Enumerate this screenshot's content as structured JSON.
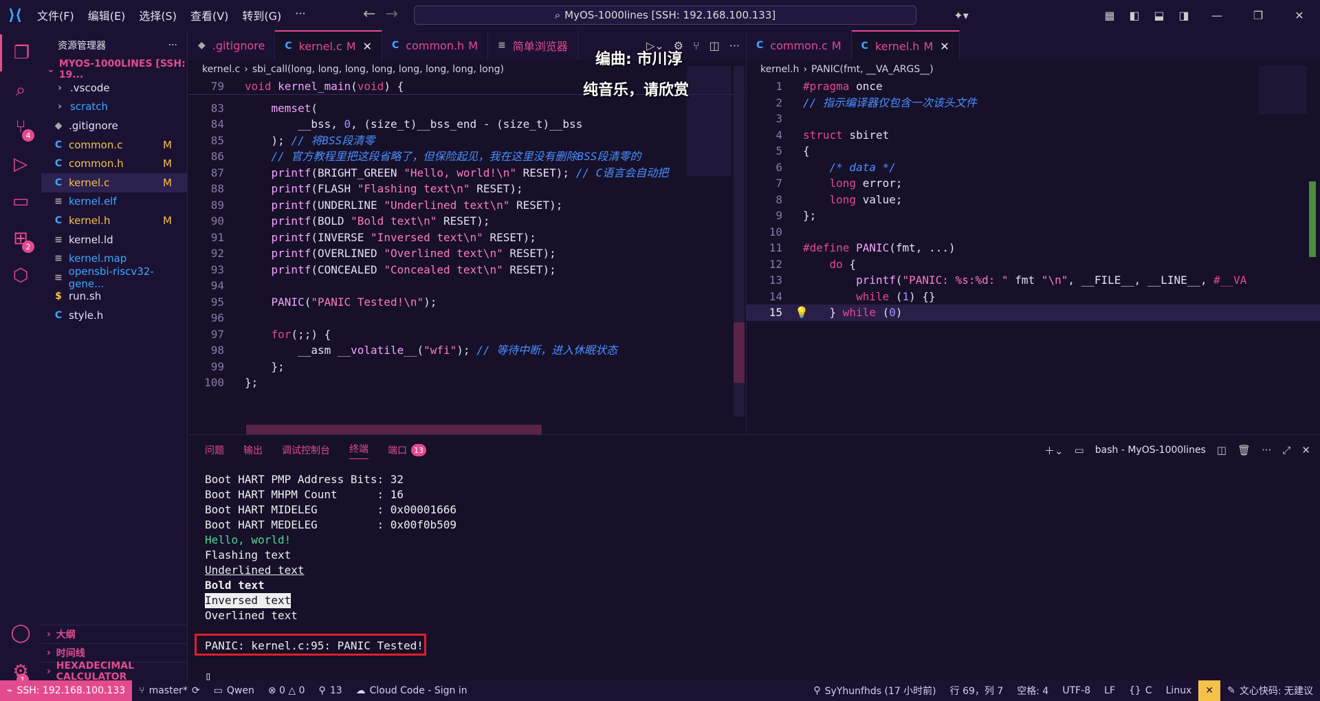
{
  "titlebar": {
    "menus": [
      "文件(F)",
      "编辑(E)",
      "选择(S)",
      "查看(V)",
      "转到(G)",
      "···"
    ],
    "command_center": "MyOS-1000lines [SSH: 192.168.100.133]"
  },
  "activity": {
    "scm_badge": "4",
    "ext_badge": "2",
    "settings_badge": "1"
  },
  "sidebar": {
    "title": "资源管理器",
    "project": "MYOS-1000LINES [SSH: 19...",
    "items": [
      {
        "icon": "›",
        "label": ".vscode",
        "color": "#e6e0f2",
        "mod": ""
      },
      {
        "icon": "›",
        "label": "scratch",
        "color": "#3fa7ff",
        "mod": ""
      },
      {
        "icon": "◆",
        "label": ".gitignore",
        "color": "#e6e0f2",
        "mod": ""
      },
      {
        "icon": "C",
        "label": "common.c",
        "color": "#f5c249",
        "mod": "M"
      },
      {
        "icon": "C",
        "label": "common.h",
        "color": "#f5c249",
        "mod": "M"
      },
      {
        "icon": "C",
        "label": "kernel.c",
        "color": "#f5c249",
        "mod": "M"
      },
      {
        "icon": "≡",
        "label": "kernel.elf",
        "color": "#3fa7ff",
        "mod": ""
      },
      {
        "icon": "C",
        "label": "kernel.h",
        "color": "#f5c249",
        "mod": "M"
      },
      {
        "icon": "≡",
        "label": "kernel.ld",
        "color": "#e6e0f2",
        "mod": ""
      },
      {
        "icon": "≡",
        "label": "kernel.map",
        "color": "#3fa7ff",
        "mod": ""
      },
      {
        "icon": "≡",
        "label": "opensbi-riscv32-gene...",
        "color": "#3fa7ff",
        "mod": ""
      },
      {
        "icon": "$",
        "label": "run.sh",
        "color": "#e6e0f2",
        "mod": ""
      },
      {
        "icon": "C",
        "label": "style.h",
        "color": "#e6e0f2",
        "mod": ""
      }
    ],
    "sections": [
      "大纲",
      "时间线",
      "HEXADECIMAL CALCULATOR"
    ]
  },
  "left_editor": {
    "tabs": [
      {
        "icon": "◆",
        "label": ".gitignore",
        "mod": ""
      },
      {
        "icon": "C",
        "label": "kernel.c",
        "mod": "M",
        "close": "✕"
      },
      {
        "icon": "C",
        "label": "common.h",
        "mod": "M"
      },
      {
        "icon": "≡",
        "label": "简单浏览器",
        "mod": ""
      }
    ],
    "breadcrumb": [
      "kernel.c",
      "sbi_call(long, long, long, long, long, long, long, long)"
    ],
    "sticky": {
      "n": "79",
      "text": "void kernel_main(void) {"
    },
    "lines": [
      {
        "n": "83",
        "text": "    memset("
      },
      {
        "n": "84",
        "text": "        __bss, 0, (size_t)__bss_end - (size_t)__bss"
      },
      {
        "n": "85",
        "text": "    ); // 将BSS段清零"
      },
      {
        "n": "86",
        "text": "    // 官方教程里把这段省略了，但保险起见，我在这里没有删除BSS段清零的"
      },
      {
        "n": "87",
        "text": "    printf(BRIGHT_GREEN \"Hello, world!\\n\" RESET); // C语言会自动把"
      },
      {
        "n": "88",
        "text": "    printf(FLASH \"Flashing text\\n\" RESET);"
      },
      {
        "n": "89",
        "text": "    printf(UNDERLINE \"Underlined text\\n\" RESET);"
      },
      {
        "n": "90",
        "text": "    printf(BOLD \"Bold text\\n\" RESET);"
      },
      {
        "n": "91",
        "text": "    printf(INVERSE \"Inversed text\\n\" RESET);"
      },
      {
        "n": "92",
        "text": "    printf(OVERLINED \"Overlined text\\n\" RESET);"
      },
      {
        "n": "93",
        "text": "    printf(CONCEALED \"Concealed text\\n\" RESET);"
      },
      {
        "n": "94",
        "text": ""
      },
      {
        "n": "95",
        "text": "    PANIC(\"PANIC Tested!\\n\");"
      },
      {
        "n": "96",
        "text": ""
      },
      {
        "n": "97",
        "text": "    for(;;) {"
      },
      {
        "n": "98",
        "text": "        __asm __volatile__(\"wfi\"); // 等待中断，进入休眠状态"
      },
      {
        "n": "99",
        "text": "    };"
      },
      {
        "n": "100",
        "text": "};"
      }
    ]
  },
  "overlay": {
    "line1": "编曲: 市川淳",
    "line2": "纯音乐，请欣赏"
  },
  "right_editor": {
    "tabs": [
      {
        "icon": "C",
        "label": "common.c",
        "mod": "M"
      },
      {
        "icon": "C",
        "label": "kernel.h",
        "mod": "M",
        "close": "✕"
      }
    ],
    "breadcrumb": [
      "kernel.h",
      "PANIC(fmt, __VA_ARGS__)"
    ],
    "lines": [
      {
        "n": "1",
        "text": "#pragma once"
      },
      {
        "n": "2",
        "text": "// 指示编译器仅包含一次该头文件"
      },
      {
        "n": "3",
        "text": ""
      },
      {
        "n": "4",
        "text": "struct sbiret"
      },
      {
        "n": "5",
        "text": "{"
      },
      {
        "n": "6",
        "text": "    /* data */"
      },
      {
        "n": "7",
        "text": "    long error;"
      },
      {
        "n": "8",
        "text": "    long value;"
      },
      {
        "n": "9",
        "text": "};"
      },
      {
        "n": "10",
        "text": ""
      },
      {
        "n": "11",
        "text": "#define PANIC(fmt, ...)"
      },
      {
        "n": "12",
        "text": "    do {"
      },
      {
        "n": "13",
        "text": "        printf(\"PANIC: %s:%d: \" fmt \"\\n\", __FILE__, __LINE__, ##__VA"
      },
      {
        "n": "14",
        "text": "        while (1) {}"
      },
      {
        "n": "15",
        "text": "    } while (0)"
      }
    ]
  },
  "panel": {
    "tabs": [
      "问题",
      "输出",
      "调试控制台",
      "终端",
      "端口"
    ],
    "ports_badge": "13",
    "terminal_name": "bash - MyOS-1000lines",
    "terminal": [
      {
        "text": "Boot HART PMP Address Bits: 32",
        "style": "plain"
      },
      {
        "text": "Boot HART MHPM Count      : 16",
        "style": "plain"
      },
      {
        "text": "Boot HART MIDELEG         : 0x00001666",
        "style": "plain"
      },
      {
        "text": "Boot HART MEDELEG         : 0x00f0b509",
        "style": "plain"
      },
      {
        "text": "Hello, world!",
        "style": "green"
      },
      {
        "text": "Flashing text",
        "style": "plain"
      },
      {
        "text": "Underlined text",
        "style": "underline"
      },
      {
        "text": "Bold text",
        "style": "bold"
      },
      {
        "text": "Inversed text",
        "style": "inverse"
      },
      {
        "text": "Overlined text",
        "style": "plain"
      },
      {
        "text": "",
        "style": "plain"
      },
      {
        "text": "PANIC: kernel.c:95: PANIC Tested!",
        "style": "plain"
      },
      {
        "text": "",
        "style": "plain"
      },
      {
        "text": "▯",
        "style": "plain"
      }
    ]
  },
  "status": {
    "ssh": "SSH: 192.168.100.133",
    "branch": "master*",
    "qwen": "Qwen",
    "problems": "⊗ 0 △ 0",
    "ports": "13",
    "cloud": "Cloud Code - Sign in",
    "author": "SyYhunfhds (17 小时前)",
    "position": "行 69，列 7",
    "spaces": "空格: 4",
    "encoding": "UTF-8",
    "eol": "LF",
    "lang": "C",
    "os": "Linux",
    "assistant": "文心快码: 无建议"
  }
}
